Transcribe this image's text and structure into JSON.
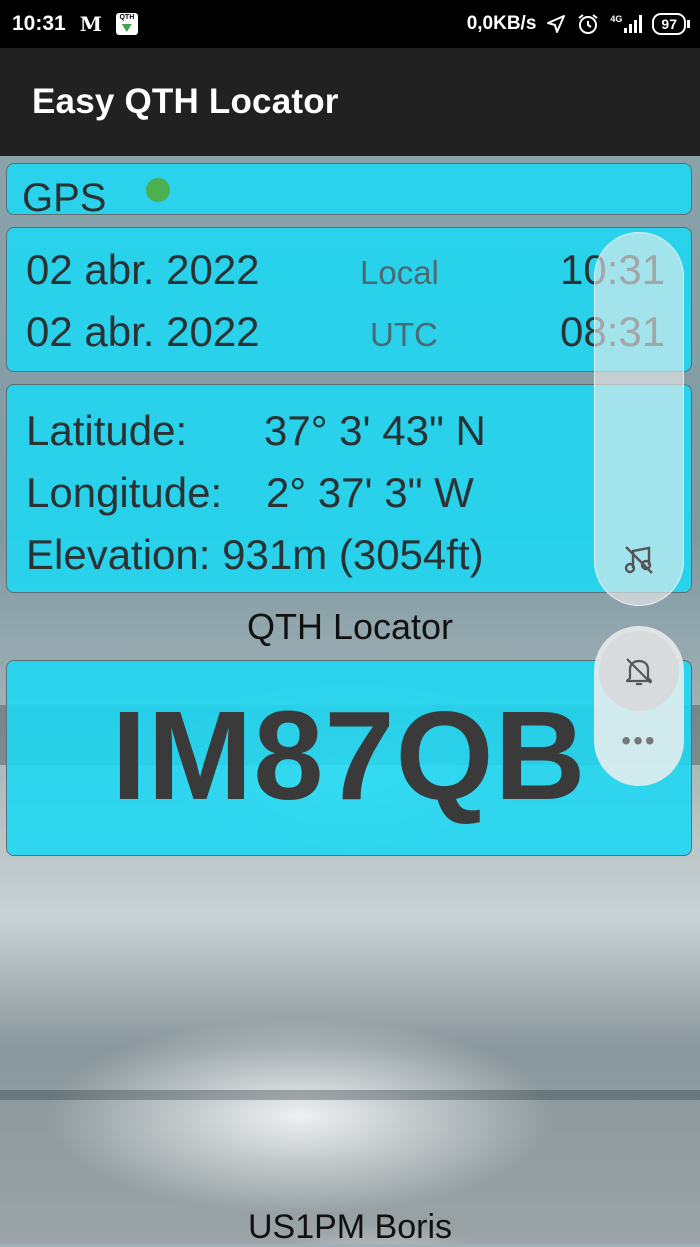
{
  "status_bar": {
    "time": "10:31",
    "mail_glyph": "M",
    "qth_badge": "QTH",
    "net_speed": "0,0KB/s",
    "network_type": "4G",
    "battery": "97",
    "icons": [
      "location-arrow-icon",
      "alarm-icon",
      "signal-icon",
      "battery-icon"
    ]
  },
  "app_bar": {
    "title": "Easy QTH Locator"
  },
  "gps": {
    "label": "GPS",
    "status_color": "#4caf50"
  },
  "time_card": {
    "rows": [
      {
        "date": "02 abr. 2022",
        "zone": "Local",
        "time": "10:31"
      },
      {
        "date": "02 abr. 2022",
        "zone": "UTC",
        "time": "08:31"
      }
    ]
  },
  "coords": {
    "latitude_label": "Latitude:",
    "latitude_value": "37° 3' 43\" N",
    "longitude_label": "Longitude:",
    "longitude_value": "2° 37' 3\" W",
    "elevation_label": "Elevation:",
    "elevation_value": "931m (3054ft)"
  },
  "locator": {
    "caption": "QTH Locator",
    "value": "IM87QB"
  },
  "footer": {
    "text": "US1PM Boris"
  },
  "floating_panel": {
    "more_glyph": "•••",
    "icons": [
      "music-off-icon",
      "bell-off-icon",
      "more-icon"
    ]
  },
  "colors": {
    "card": "#1cd8f4",
    "appbar": "#212121",
    "statusbar": "#000000"
  }
}
